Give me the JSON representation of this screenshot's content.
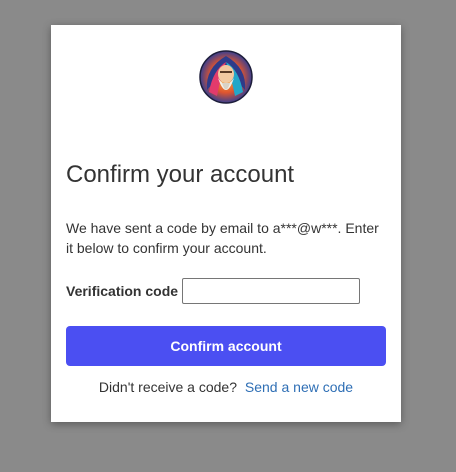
{
  "form": {
    "title": "Confirm your account",
    "message": "We have sent a code by email to a***@w***. Enter it below to confirm your account.",
    "code_label": "Verification code",
    "code_value": "",
    "code_placeholder": "",
    "confirm_label": "Confirm account",
    "resend_prompt": "Didn't receive a code?",
    "resend_link": "Send a new code"
  },
  "colors": {
    "backdrop": "#8a8a8a",
    "card": "#ffffff",
    "primary_button": "#4b4ff2",
    "link": "#2f6fb5",
    "text": "#333333"
  },
  "icons": {
    "logo": "wizard-avatar-logo-icon"
  }
}
